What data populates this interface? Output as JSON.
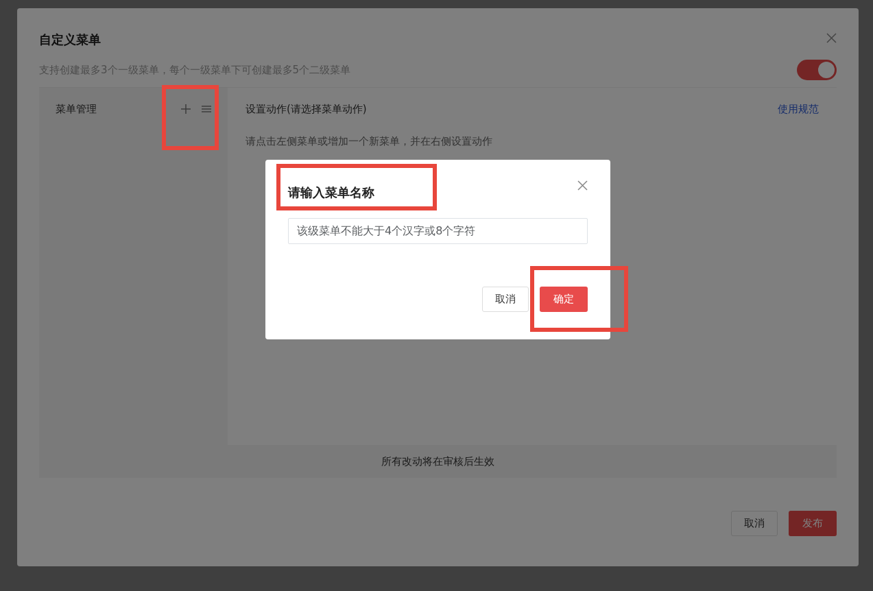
{
  "dialog": {
    "title": "自定义菜单",
    "subtitle": "支持创建最多3个一级菜单，每个一级菜单下可创建最多5个二级菜单",
    "toggle": {
      "on": true
    },
    "menu_panel": {
      "title": "菜单管理"
    },
    "action_panel": {
      "title": "设置动作(请选择菜单动作)",
      "link": "使用规范",
      "hint": "请点击左侧菜单或增加一个新菜单，并在右侧设置动作"
    },
    "notice": "所有改动将在审核后生效",
    "buttons": [
      {
        "label": "取消",
        "kind": "secondary"
      },
      {
        "label": "发布",
        "kind": "primary"
      }
    ]
  },
  "prompt": {
    "title": "请输入菜单名称",
    "placeholder": "该级菜单不能大于4个汉字或8个字符",
    "buttons": [
      {
        "label": "取消",
        "kind": "secondary"
      },
      {
        "label": "确定",
        "kind": "primary"
      }
    ]
  }
}
